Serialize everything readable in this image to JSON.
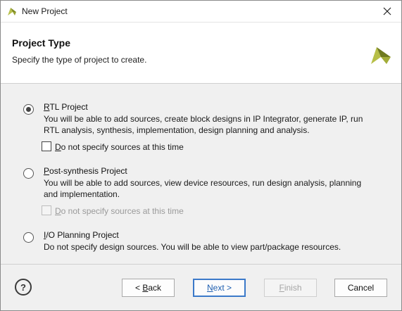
{
  "window": {
    "title": "New Project",
    "close_label": "×"
  },
  "header": {
    "title": "Project Type",
    "subtitle": "Specify the type of project to create."
  },
  "options": [
    {
      "mnemonic": "R",
      "label_rest": "TL Project",
      "selected": true,
      "desc_lines": [
        "You will be able to add sources, create block designs in IP Integrator, generate IP, run",
        "RTL analysis, synthesis, implementation, design planning and analysis."
      ],
      "checkbox": {
        "mnemonic": "D",
        "label_rest": "o not specify sources at this time",
        "checked": false,
        "enabled": true
      }
    },
    {
      "mnemonic": "P",
      "label_rest": "ost-synthesis Project",
      "selected": false,
      "desc_lines": [
        "You will be able to add sources, view device resources, run design analysis, planning",
        "and implementation."
      ],
      "checkbox": {
        "mnemonic": "D",
        "label_rest": "o not specify sources at this time",
        "checked": false,
        "enabled": false
      }
    },
    {
      "mnemonic": "I",
      "label_rest": "/O Planning Project",
      "selected": false,
      "desc_lines": [
        "Do not specify design sources. You will be able to view part/package resources."
      ]
    }
  ],
  "footer": {
    "help_label": "?",
    "back": {
      "prefix": "< ",
      "mnemonic": "B",
      "rest": "ack"
    },
    "next": {
      "mnemonic": "N",
      "rest": "ext >"
    },
    "finish": {
      "mnemonic": "F",
      "rest": "inish"
    },
    "cancel": "Cancel"
  },
  "icons": {
    "app": "vivado-logo-icon",
    "close": "close-icon",
    "help": "help-icon"
  },
  "colors": {
    "logo_light": "#b5bd4a",
    "logo_dark": "#6f7a1f",
    "primary_border": "#3b79c9"
  }
}
